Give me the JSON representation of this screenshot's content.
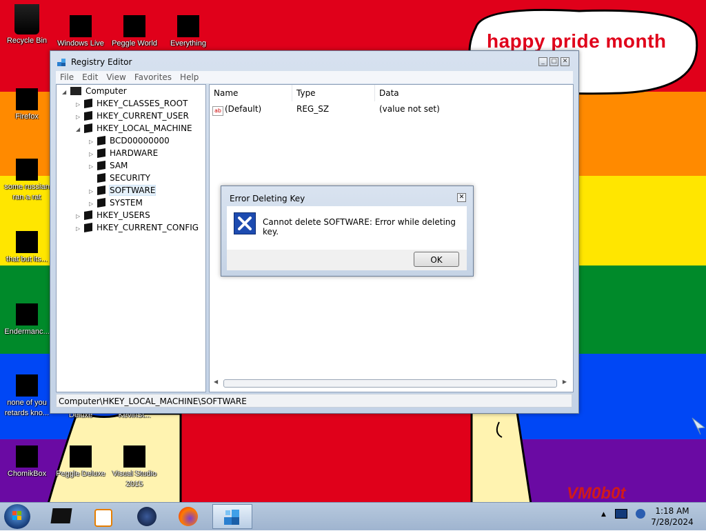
{
  "wallpaper": {
    "bubble_text": "happy pride month",
    "watermark": "VM0b0t"
  },
  "desktop_icons": [
    {
      "label": "Recycle Bin",
      "icon": "recycle-bin-icon"
    },
    {
      "label": "Windows Live",
      "icon": "windows-live-icon"
    },
    {
      "label": "Peggle World",
      "icon": "peggle-world-icon"
    },
    {
      "label": "Everything",
      "icon": "everything-icon"
    },
    {
      "label": "Firefox",
      "icon": "firefox-icon"
    },
    {
      "label": "some russian ran a rat",
      "icon": "russian-rat-icon"
    },
    {
      "label": "that but its...",
      "icon": "shortcut-icon"
    },
    {
      "label": "Endermanc...",
      "icon": "endermanch-icon"
    },
    {
      "label": "none of you retards kno...",
      "icon": "none-of-you-icon"
    },
    {
      "label": "Deluxe",
      "icon": "deluxe-icon"
    },
    {
      "label": "KevinSt...",
      "icon": "kevin-icon"
    },
    {
      "label": "ChomikBox",
      "icon": "chomikbox-icon"
    },
    {
      "label": "Peggle Deluxe",
      "icon": "peggle-deluxe-icon"
    },
    {
      "label": "Visual Studio 2015",
      "icon": "visual-studio-icon"
    }
  ],
  "regedit": {
    "title": "Registry Editor",
    "menu": [
      "File",
      "Edit",
      "View",
      "Favorites",
      "Help"
    ],
    "tree": [
      {
        "label": "Computer",
        "expander": "◢"
      },
      {
        "label": "HKEY_CLASSES_ROOT",
        "expander": "▷"
      },
      {
        "label": "HKEY_CURRENT_USER",
        "expander": "▷"
      },
      {
        "label": "HKEY_LOCAL_MACHINE",
        "expander": "◢"
      },
      {
        "label": "BCD00000000",
        "expander": "▷"
      },
      {
        "label": "HARDWARE",
        "expander": "▷"
      },
      {
        "label": "SAM",
        "expander": "▷"
      },
      {
        "label": "SECURITY",
        "expander": ""
      },
      {
        "label": "SOFTWARE",
        "expander": "▷",
        "selected": true
      },
      {
        "label": "SYSTEM",
        "expander": "▷"
      },
      {
        "label": "HKEY_USERS",
        "expander": "▷"
      },
      {
        "label": "HKEY_CURRENT_CONFIG",
        "expander": "▷"
      }
    ],
    "columns": [
      "Name",
      "Type",
      "Data"
    ],
    "values": [
      {
        "name": "(Default)",
        "type": "REG_SZ",
        "data": "(value not set)"
      }
    ],
    "status": "Computer\\HKEY_LOCAL_MACHINE\\SOFTWARE"
  },
  "dialog": {
    "title": "Error Deleting Key",
    "message": "Cannot delete SOFTWARE:  Error while deleting key.",
    "ok": "OK"
  },
  "taskbar": {
    "time": "1:18 AM",
    "date": "7/28/2024"
  },
  "colors": {
    "stripe_red": "#e0001a",
    "stripe_orange": "#ff8a00",
    "stripe_yellow": "#ffe600",
    "stripe_green": "#008a2a",
    "stripe_blue": "#0047f5",
    "stripe_purple": "#6a0aa3"
  }
}
